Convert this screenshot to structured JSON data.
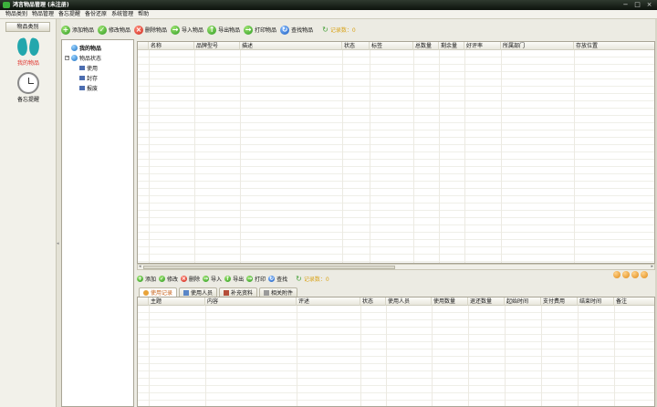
{
  "window": {
    "title": "鸿言物品管理 (未注册)",
    "controls": [
      "−",
      "□",
      "×"
    ]
  },
  "menu": [
    "物品类别",
    "物品管理",
    "备忘提醒",
    "备份还原",
    "系统管理",
    "帮助"
  ],
  "sidebar": {
    "header": "物品类别",
    "items": [
      {
        "label": "我的物品",
        "icon": "butterfly-icon",
        "active": true
      },
      {
        "label": "备忘提醒",
        "icon": "clock-icon",
        "active": false
      }
    ],
    "collapse_glyph": "◂"
  },
  "toolbar": {
    "buttons": [
      {
        "label": "添加物品",
        "icon": "add-icon",
        "color": "green",
        "glyph": "+"
      },
      {
        "label": "修改物品",
        "icon": "edit-icon",
        "color": "green",
        "glyph": "✓"
      },
      {
        "label": "删除物品",
        "icon": "delete-icon",
        "color": "red",
        "glyph": "×"
      },
      {
        "label": "导入物品",
        "icon": "import-icon",
        "color": "green",
        "glyph": "→"
      },
      {
        "label": "导出物品",
        "icon": "export-icon",
        "color": "green",
        "glyph": "↑"
      },
      {
        "label": "打印物品",
        "icon": "print-icon",
        "color": "green",
        "glyph": "→"
      },
      {
        "label": "查找物品",
        "icon": "search-icon",
        "color": "blue",
        "glyph": "↻"
      }
    ],
    "record_count": "记录数：0"
  },
  "tree": {
    "root": "我的物品",
    "group": "物品状态",
    "group_expander": "−",
    "children": [
      "使用",
      "封存",
      "报废"
    ]
  },
  "main_grid": {
    "columns": [
      "名称",
      "品牌型号",
      "描述",
      "状态",
      "标签",
      "总数量",
      "剩余量",
      "好评率",
      "所属部门",
      "存放位置"
    ]
  },
  "scrollbar": {
    "left_arrow": "◂",
    "right_arrow": "▸"
  },
  "detail_toolbar": {
    "buttons": [
      {
        "label": "添加",
        "color": "green",
        "glyph": "+"
      },
      {
        "label": "修改",
        "color": "green",
        "glyph": "✓"
      },
      {
        "label": "删除",
        "color": "red",
        "glyph": "×"
      },
      {
        "label": "导入",
        "color": "green",
        "glyph": "→"
      },
      {
        "label": "导出",
        "color": "green",
        "glyph": "↑"
      },
      {
        "label": "打印",
        "color": "green",
        "glyph": "→"
      },
      {
        "label": "查找",
        "color": "blue",
        "glyph": "↻"
      }
    ],
    "record_count": "记录数：0"
  },
  "detail_tabs": [
    {
      "label": "使用记录",
      "active": true
    },
    {
      "label": "使用人员",
      "active": false
    },
    {
      "label": "补充资料",
      "active": false
    },
    {
      "label": "相关附件",
      "active": false
    }
  ],
  "detail_grid": {
    "columns": [
      "主题",
      "内容",
      "评述",
      "状态",
      "使用人员",
      "使用数量",
      "退还数量",
      "起始时间",
      "支付费用",
      "结束时间",
      "备注"
    ]
  },
  "colors": {
    "accent_red": "#e0302a",
    "count_color": "#d9a41c",
    "active_tab": "#c7621a"
  }
}
